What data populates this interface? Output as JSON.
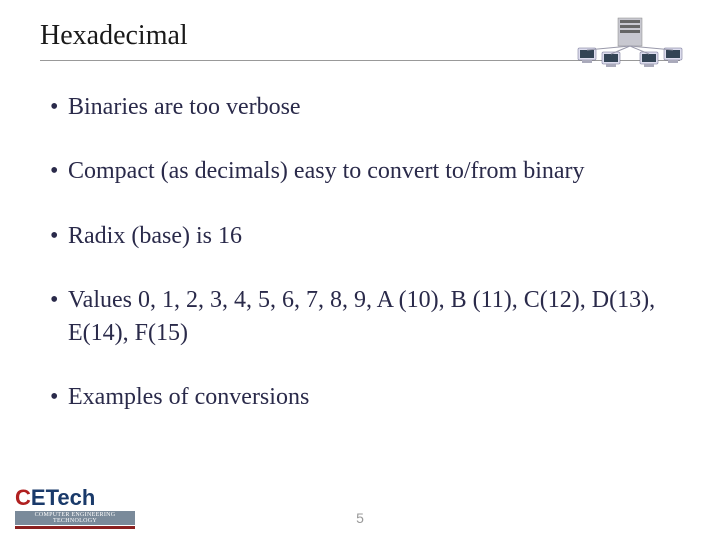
{
  "title": "Hexadecimal",
  "bullets": [
    "Binaries are too verbose",
    "Compact (as decimals) easy to convert to/from binary",
    "Radix (base) is 16",
    "Values 0, 1, 2, 3, 4, 5, 6, 7, 8, 9, A (10), B (11), C(12), D(13), E(14), F(15)",
    "Examples of conversions"
  ],
  "page_number": "5",
  "logo": {
    "main_c": "C",
    "main_rest": "ETech",
    "sub": "COMPUTER ENGINEERING TECHNOLOGY"
  }
}
